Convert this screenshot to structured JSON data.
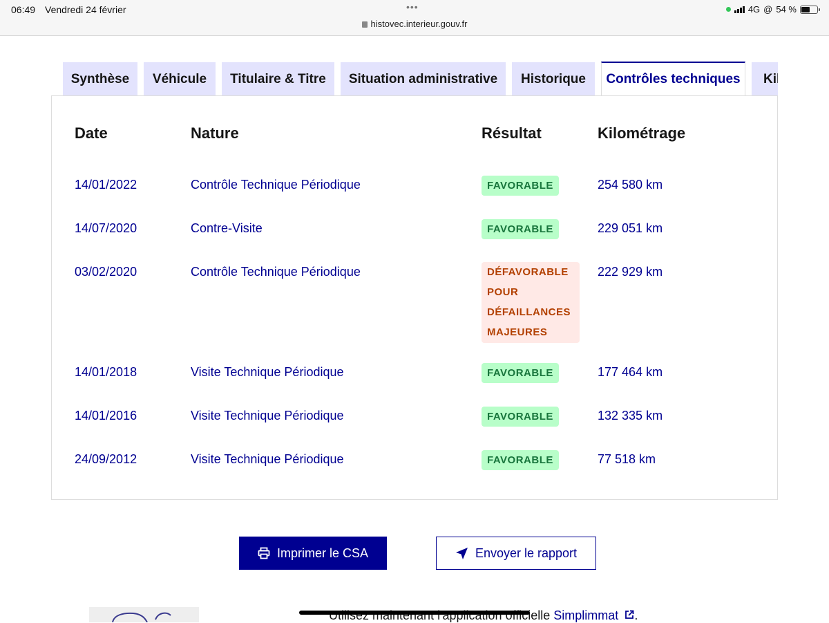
{
  "statusbar": {
    "time": "06:49",
    "date": "Vendredi 24 février",
    "url": "histovec.interieur.gouv.fr",
    "network": "4G",
    "battery": "54 %",
    "battery_level_percent": 54
  },
  "tabs": [
    {
      "label": "Synthèse"
    },
    {
      "label": "Véhicule"
    },
    {
      "label": "Titulaire & Titre"
    },
    {
      "label": "Situation administrative"
    },
    {
      "label": "Historique"
    },
    {
      "label": "Contrôles techniques"
    },
    {
      "label": "Kilo"
    }
  ],
  "table": {
    "headers": [
      "Date",
      "Nature",
      "Résultat",
      "Kilométrage"
    ],
    "rows": [
      {
        "date": "14/01/2022",
        "nature": "Contrôle Technique Périodique",
        "result": "FAVORABLE",
        "status": "ok",
        "km": "254 580 km"
      },
      {
        "date": "14/07/2020",
        "nature": "Contre-Visite",
        "result": "FAVORABLE",
        "status": "ok",
        "km": "229 051 km"
      },
      {
        "date": "03/02/2020",
        "nature": "Contrôle Technique Périodique",
        "result": "DÉFAVORABLE POUR DÉFAILLANCES MAJEURES",
        "status": "ko",
        "km": "222 929 km"
      },
      {
        "date": "14/01/2018",
        "nature": "Visite Technique Périodique",
        "result": "FAVORABLE",
        "status": "ok",
        "km": "177 464 km"
      },
      {
        "date": "14/01/2016",
        "nature": "Visite Technique Périodique",
        "result": "FAVORABLE",
        "status": "ok",
        "km": "132 335 km"
      },
      {
        "date": "24/09/2012",
        "nature": "Visite Technique Périodique",
        "result": "FAVORABLE",
        "status": "ok",
        "km": "77 518 km"
      }
    ]
  },
  "actions": {
    "print_label": "Imprimer le CSA",
    "send_label": "Envoyer le rapport"
  },
  "promo": {
    "text": "Utilisez maintenant l'application officielle ",
    "link": "Simplimmat",
    "end": "."
  },
  "icons": {
    "lock": "lock-icon",
    "print": "printer-icon",
    "send": "send-icon",
    "external": "external-link-icon"
  }
}
